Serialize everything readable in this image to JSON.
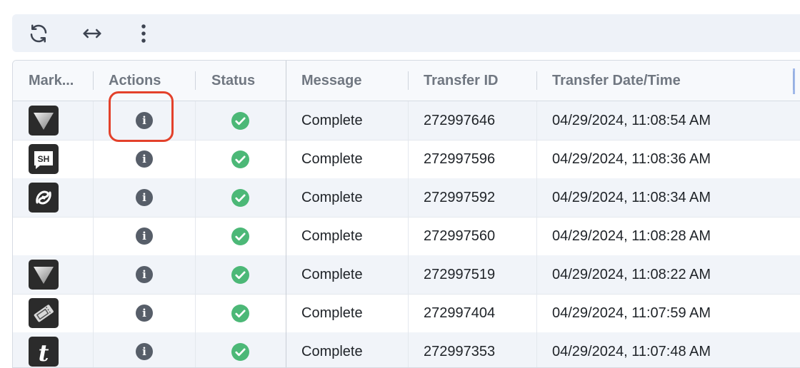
{
  "toolbar": {
    "buttons": [
      {
        "icon": "refresh-icon"
      },
      {
        "icon": "resize-columns-icon"
      },
      {
        "icon": "more-vertical-icon"
      }
    ]
  },
  "table": {
    "headers": {
      "market": "Mark...",
      "actions": "Actions",
      "status": "Status",
      "message": "Message",
      "transfer_id": "Transfer ID",
      "transfer_datetime": "Transfer Date/Time"
    },
    "rows": [
      {
        "market": "triangle-logo",
        "action_icon": "info-icon",
        "status": "success",
        "message": "Complete",
        "transfer_id": "272997646",
        "transfer_datetime": "04/29/2024, 11:08:54 AM"
      },
      {
        "market": "sh-logo",
        "action_icon": "info-icon",
        "status": "success",
        "message": "Complete",
        "transfer_id": "272997596",
        "transfer_datetime": "04/29/2024, 11:08:36 AM"
      },
      {
        "market": "swirl-logo",
        "action_icon": "info-icon",
        "status": "success",
        "message": "Complete",
        "transfer_id": "272997592",
        "transfer_datetime": "04/29/2024, 11:08:34 AM"
      },
      {
        "market": "",
        "action_icon": "info-icon",
        "status": "success",
        "message": "Complete",
        "transfer_id": "272997560",
        "transfer_datetime": "04/29/2024, 11:08:28 AM"
      },
      {
        "market": "triangle-logo",
        "action_icon": "info-icon",
        "status": "success",
        "message": "Complete",
        "transfer_id": "272997519",
        "transfer_datetime": "04/29/2024, 11:08:22 AM"
      },
      {
        "market": "ticket-logo",
        "action_icon": "info-icon",
        "status": "success",
        "message": "Complete",
        "transfer_id": "272997404",
        "transfer_datetime": "04/29/2024, 11:07:59 AM"
      },
      {
        "market": "t-logo",
        "action_icon": "info-icon",
        "status": "success",
        "message": "Complete",
        "transfer_id": "272997353",
        "transfer_datetime": "04/29/2024, 11:07:48 AM"
      }
    ]
  },
  "market_logo_text": {
    "sh": "SH",
    "t": "t"
  },
  "info_glyph": "i",
  "colors": {
    "success": "#4cb877",
    "info": "#575e69",
    "highlight": "#e3412b",
    "row_alt": "#f1f4f9",
    "header_text": "#707781"
  }
}
